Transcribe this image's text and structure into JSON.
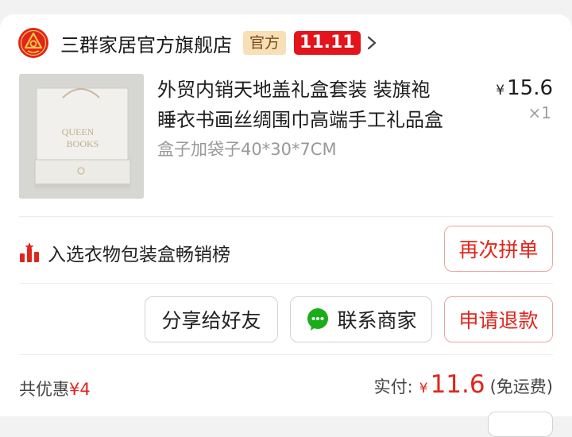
{
  "shop": {
    "name": "三群家居官方旗舰店",
    "official_badge": "官方",
    "promo_badge": "11.11"
  },
  "product": {
    "title_line1": "外贸内销天地盖礼盒套装 装旗袍",
    "title_line2": "睡衣书画丝绸围巾高端手工礼品盒",
    "spec": "盒子加袋子40*30*7CM",
    "price_symbol": "¥",
    "price": "15.6",
    "quantity": "×1",
    "thumb_text_1": "QUEEN",
    "thumb_text_2": "BOOKS"
  },
  "ranking": {
    "text": "入选衣物包装盒畅销榜"
  },
  "buttons": {
    "reorder": "再次拼单",
    "share": "分享给好友",
    "contact": "联系商家",
    "refund": "申请退款"
  },
  "summary": {
    "discount_label": "共优惠",
    "discount_amount": "¥4",
    "paid_label": "实付:",
    "paid_symbol": "¥",
    "paid_amount": "11.6",
    "shipping_note": "(免运费)"
  },
  "colors": {
    "accent_red": "#e1251b",
    "official_badge_bg": "#f7dfb8",
    "page_bg": "#f2f2f2"
  }
}
